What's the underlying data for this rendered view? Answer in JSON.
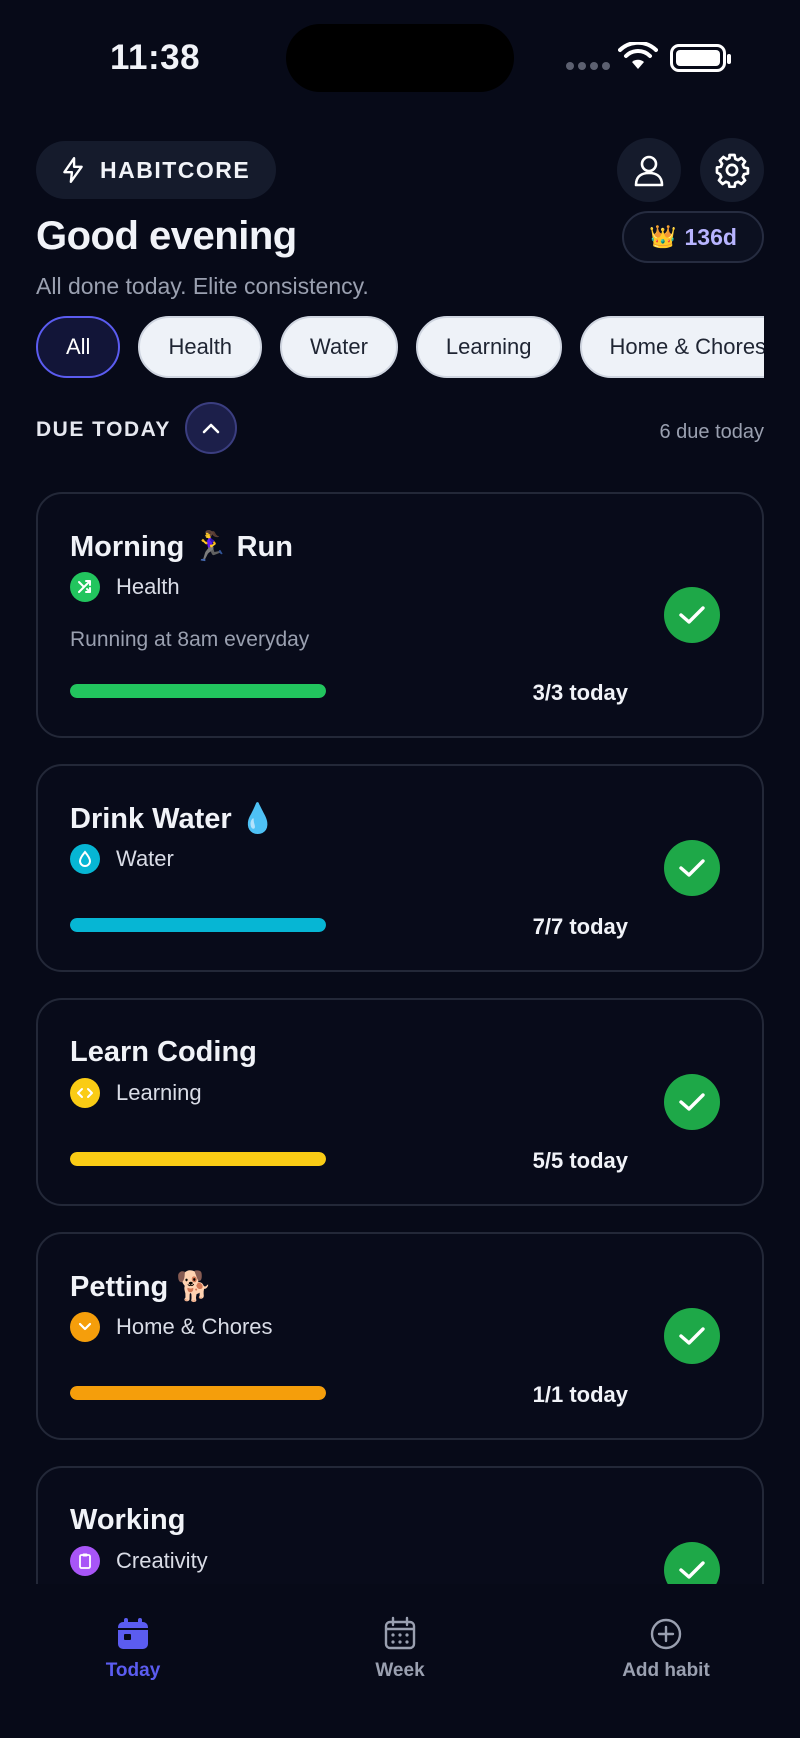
{
  "status_bar": {
    "time": "11:38"
  },
  "header": {
    "brand_label": "HABITCORE",
    "greeting": "Good evening",
    "subtitle": "All done today. Elite consistency.",
    "streak_icon": "👑",
    "streak_value": "136d"
  },
  "filters": [
    "All",
    "Health",
    "Water",
    "Learning",
    "Home & Chores"
  ],
  "active_filter": "All",
  "due": {
    "title": "DUE TODAY",
    "count_label": "6 due today"
  },
  "habits": [
    {
      "title": "Morning 🏃‍♀️ Run",
      "category": "Health",
      "category_icon": "shuffle-icon",
      "color": "#22c55e",
      "description": "Running at 8am everyday",
      "progress_label": "3/3 today",
      "progress": 1.0,
      "done": true
    },
    {
      "title": "Drink Water 💧",
      "category": "Water",
      "category_icon": "droplet-icon",
      "color": "#06b6d4",
      "description": "",
      "progress_label": "7/7 today",
      "progress": 1.0,
      "done": true
    },
    {
      "title": "Learn Coding",
      "category": "Learning",
      "category_icon": "code-icon",
      "color": "#facc15",
      "description": "",
      "progress_label": "5/5 today",
      "progress": 1.0,
      "done": true
    },
    {
      "title": "Petting 🐕",
      "category": "Home & Chores",
      "category_icon": "chevron-down-icon",
      "color": "#f59e0b",
      "description": "",
      "progress_label": "1/1 today",
      "progress": 1.0,
      "done": true
    },
    {
      "title": "Working",
      "category": "Creativity",
      "category_icon": "clipboard-icon",
      "color": "#a855f7",
      "description": "",
      "progress_label": "",
      "progress": 1.0,
      "done": true
    }
  ],
  "nav": {
    "today": "Today",
    "week": "Week",
    "add": "Add habit",
    "active": "Today",
    "accent": "#5b5cf0"
  }
}
